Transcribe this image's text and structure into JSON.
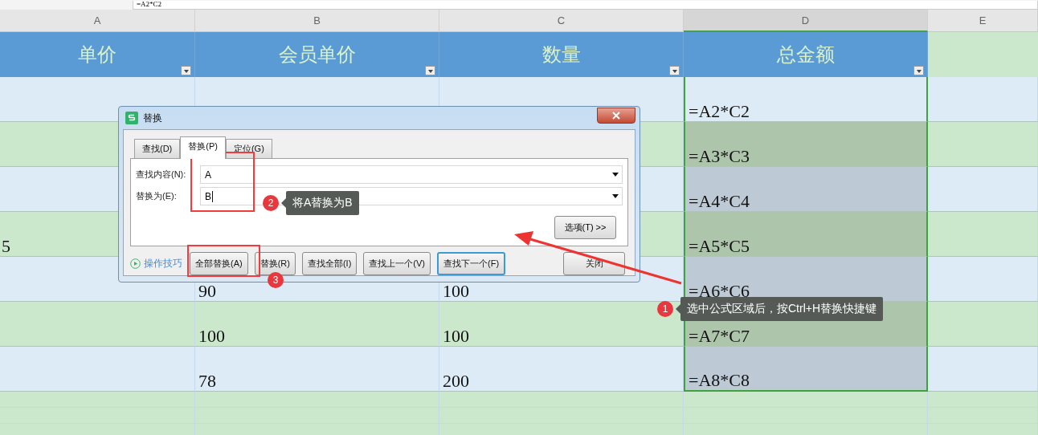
{
  "formula_bar": {
    "value": "=A2*C2"
  },
  "columns": [
    {
      "label": "A",
      "selected": false
    },
    {
      "label": "B",
      "selected": false
    },
    {
      "label": "C",
      "selected": false
    },
    {
      "label": "D",
      "selected": true
    },
    {
      "label": "E",
      "selected": false
    }
  ],
  "headers": [
    "单价",
    "会员单价",
    "数量",
    "总金额"
  ],
  "rows": [
    {
      "d": "=A2*C2",
      "highlighted": false
    },
    {
      "d": "=A3*C3",
      "highlighted": true
    },
    {
      "d": "=A4*C4",
      "highlighted": true
    },
    {
      "a": "5",
      "d": "=A5*C5",
      "highlighted": true
    },
    {
      "b": "90",
      "c": "100",
      "d": "=A6*C6",
      "highlighted": true
    },
    {
      "b": "100",
      "c": "100",
      "d": "=A7*C7",
      "highlighted": true
    },
    {
      "b": "78",
      "c": "200",
      "d": "=A8*C8",
      "highlighted": true
    }
  ],
  "dialog": {
    "title": "替换",
    "tabs": [
      {
        "label": "查找(D)",
        "selected": false
      },
      {
        "label": "替换(P)",
        "selected": true
      },
      {
        "label": "定位(G)",
        "selected": false
      }
    ],
    "fields": [
      {
        "label": "查找内容(N):",
        "value": "A"
      },
      {
        "label": "替换为(E):",
        "value": "B"
      }
    ],
    "options_button": "选项(T) >>",
    "tips_link": "操作技巧",
    "buttons": [
      {
        "label": "全部替换(A)",
        "focused": false
      },
      {
        "label": "替换(R)",
        "focused": false
      },
      {
        "label": "查找全部(I)",
        "focused": false
      },
      {
        "label": "查找上一个(V)",
        "focused": false
      },
      {
        "label": "查找下一个(F)",
        "focused": true
      }
    ],
    "close_button": "关闭"
  },
  "callouts": [
    {
      "number": "2",
      "text": "将A替换为B"
    },
    {
      "number": "3"
    },
    {
      "number": "1",
      "text": "选中公式区域后，按Ctrl+H替换快捷键"
    }
  ]
}
